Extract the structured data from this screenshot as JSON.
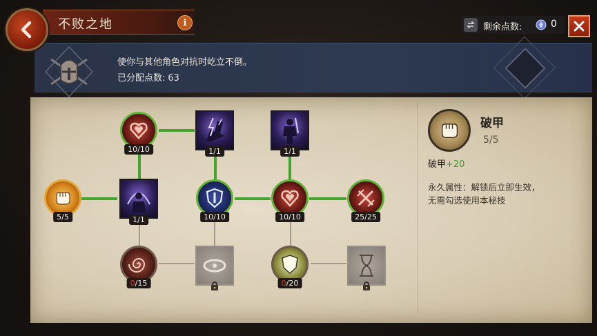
{
  "header": {
    "title": "不败之地",
    "info_label": "i",
    "points_label": "剩余点数:",
    "points_value": "0",
    "close_label": "✕"
  },
  "description": {
    "text": "使你与其他角色对抗时屹立不倒。",
    "allocated_label": "已分配点数:",
    "allocated_value": "63"
  },
  "tree": {
    "nodes": [
      {
        "id": "heart-shield",
        "count": "10/10",
        "state": "maxed"
      },
      {
        "id": "lightning-boot",
        "count": "1/1",
        "state": "maxed"
      },
      {
        "id": "warrior-figure",
        "count": "1/1",
        "state": "maxed"
      },
      {
        "id": "fist",
        "count": "5/5",
        "state": "maxed"
      },
      {
        "id": "dome-figure",
        "count": "1/1",
        "state": "maxed"
      },
      {
        "id": "blade-shield",
        "count": "10/10",
        "state": "maxed"
      },
      {
        "id": "heart-shield-2",
        "count": "10/10",
        "state": "maxed"
      },
      {
        "id": "crossed-swords",
        "count": "25/25",
        "state": "maxed"
      },
      {
        "id": "vortex",
        "count_current": "0",
        "count_max": "/15",
        "state": "available"
      },
      {
        "id": "chain-locked",
        "state": "locked"
      },
      {
        "id": "shield-plain",
        "count_current": "0",
        "count_max": "/20",
        "state": "available"
      },
      {
        "id": "hourglass-locked",
        "state": "locked"
      }
    ]
  },
  "detail": {
    "name": "破甲",
    "level": "5/5",
    "stat_name": "破甲",
    "stat_bonus": "+20",
    "permanent_line1": "永久属性：解锁后立即生效，",
    "permanent_line2": "无需勾选使用本秘技"
  },
  "colors": {
    "connector_active": "#43a52b",
    "stat_bonus": "#3e9b2a",
    "zero_count": "#e0351d",
    "close_button": "#c2391a"
  }
}
